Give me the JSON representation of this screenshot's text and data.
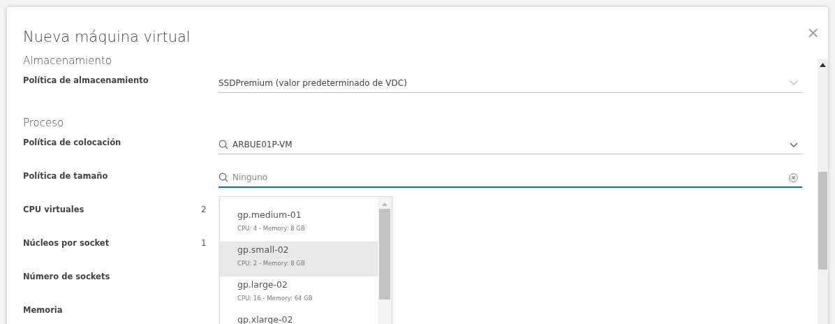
{
  "dialog": {
    "title": "Nueva máquina virtual",
    "close": "×"
  },
  "sections": [
    {
      "heading": "Almacenamiento",
      "rows": [
        {
          "label": "Política de almacenamiento",
          "kind": "select",
          "value": "SSDPremium (valor predeterminado de VDC)",
          "search": false,
          "disabled": true
        }
      ]
    },
    {
      "heading": "Proceso",
      "rows": [
        {
          "label": "Política de colocación",
          "kind": "select",
          "value": "ARBUE01P-VM",
          "search": true,
          "disabled": false
        },
        {
          "label": "Política de tamaño",
          "kind": "combo",
          "placeholder": "Ninguno",
          "focused": true
        },
        {
          "label": "CPU virtuales",
          "kind": "text",
          "value": "2"
        },
        {
          "label": "Núcleos por socket",
          "kind": "text",
          "value": "1"
        },
        {
          "label": "Número de sockets",
          "kind": "text"
        },
        {
          "label": "Memoria",
          "kind": "text"
        }
      ]
    }
  ],
  "dropdown": {
    "options": [
      {
        "name": "gp.medium-01",
        "detail": "CPU: 4 - Memory: 8 GB",
        "selected": false
      },
      {
        "name": "gp.small-02",
        "detail": "CPU: 2 - Memory: 8 GB",
        "selected": true
      },
      {
        "name": "gp.large-02",
        "detail": "CPU: 16 - Memory: 64 GB",
        "selected": false
      },
      {
        "name": "gp.xlarge-02",
        "selected": false
      }
    ]
  }
}
